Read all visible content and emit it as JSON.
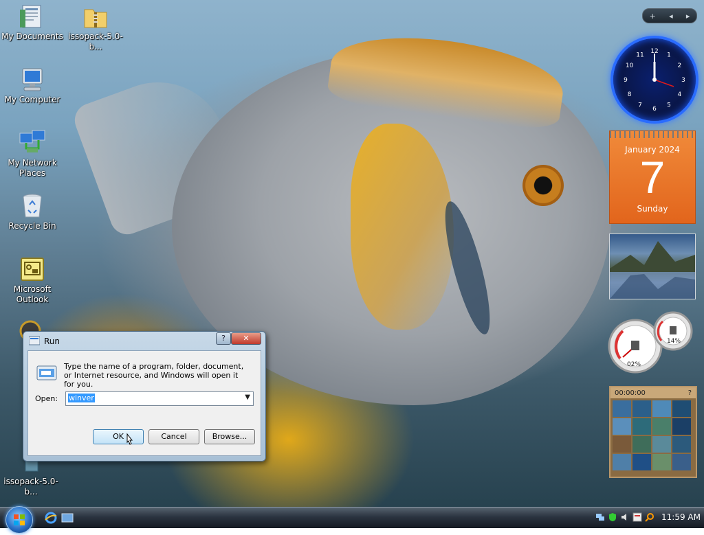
{
  "desktop": {
    "icons": [
      {
        "label": "My Documents"
      },
      {
        "label": "issopack-5.0-b..."
      },
      {
        "label": "My Computer"
      },
      {
        "label": "My Network Places"
      },
      {
        "label": "Recycle Bin"
      },
      {
        "label": "Microsoft Outlook"
      },
      {
        "label": "issopack-5.0-b..."
      }
    ]
  },
  "sidebar": {
    "controls": {
      "add": "+",
      "prev": "◂",
      "next": "▸"
    },
    "clock": {
      "hour": 12,
      "minute": 0,
      "numerals": [
        "12",
        "1",
        "2",
        "3",
        "4",
        "5",
        "6",
        "7",
        "8",
        "9",
        "10",
        "11"
      ]
    },
    "calendar": {
      "month_year": "January 2024",
      "day": "7",
      "weekday": "Sunday"
    },
    "cpu_meter": {
      "cpu": "02%",
      "memory": "14%"
    },
    "puzzle": {
      "timer": "00:00:00",
      "help": "?"
    }
  },
  "run_dialog": {
    "title": "Run",
    "help_button": "?",
    "close_button": "✕",
    "description": "Type the name of a program, folder, document, or Internet resource, and Windows will open it for you.",
    "open_label": "Open:",
    "open_value": "winver",
    "ok_label": "OK",
    "cancel_label": "Cancel",
    "browse_label": "Browse..."
  },
  "taskbar": {
    "clock": "11:59 AM"
  }
}
